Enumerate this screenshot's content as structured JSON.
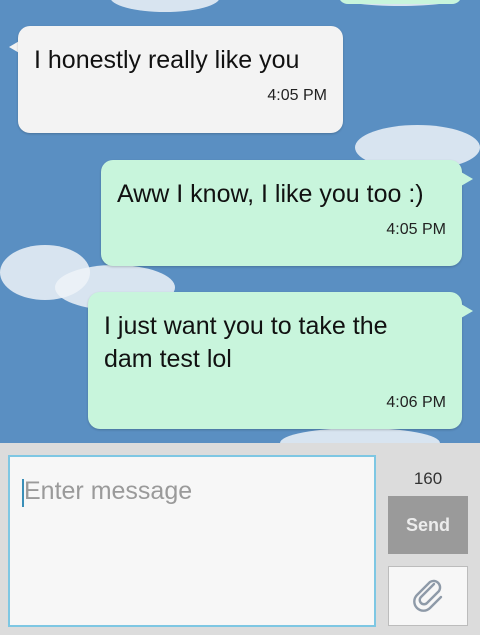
{
  "messages": [
    {
      "direction": "incoming",
      "text": "I honestly really like you",
      "time": "4:05 PM"
    },
    {
      "direction": "outgoing",
      "text": "Aww I know, I like you too :)",
      "time": "4:05 PM"
    },
    {
      "direction": "outgoing",
      "text": "I just want you to take the dam test lol",
      "time": "4:06 PM"
    }
  ],
  "composer": {
    "placeholder": "Enter message",
    "char_counter": "160",
    "send_label": "Send",
    "attach_icon": "paperclip-icon"
  },
  "colors": {
    "background_sky": "#5a8fc2",
    "incoming_bubble": "#f3f3f3",
    "outgoing_bubble": "#c8f5dc",
    "input_border": "#7ec7e3",
    "send_button": "#9a9a9a"
  }
}
